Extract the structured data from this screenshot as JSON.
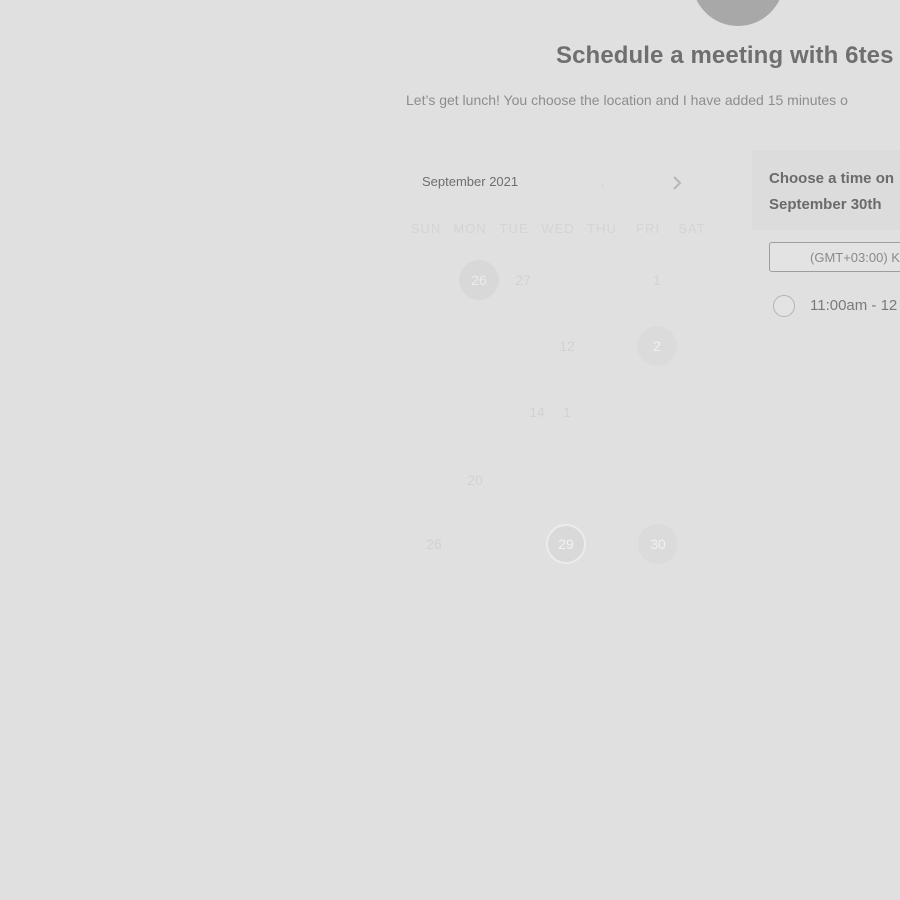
{
  "header": {
    "title": "Schedule a meeting with 6tes",
    "description": "Let’s get lunch! You choose the location and I have added 15 minutes o"
  },
  "calendar": {
    "month_label": "September 2021",
    "prev_icon": "chevron-left-icon",
    "next_icon": "chevron-right-icon",
    "weekdays": [
      "SUN",
      "MON",
      "TUE",
      "WED",
      "THU",
      "FRI",
      "SAT"
    ],
    "days": [
      {
        "label": "26",
        "state": "today"
      },
      {
        "label": "27",
        "state": "past"
      },
      {
        "label": "1",
        "state": "past"
      },
      {
        "label": "12",
        "state": "past"
      },
      {
        "label": "2",
        "state": "available"
      },
      {
        "label": "14",
        "state": "past"
      },
      {
        "label": "1",
        "state": "past"
      },
      {
        "label": "20",
        "state": "past"
      },
      {
        "label": "26",
        "state": "past"
      },
      {
        "label": "29",
        "state": "selected"
      },
      {
        "label": "30",
        "state": "available"
      }
    ]
  },
  "times": {
    "heading": "Choose a time on September 30th",
    "heading_line1": "Choose a time on",
    "heading_line2": "September 30th",
    "timezone": "(GMT+03:00) K",
    "slots": [
      {
        "label": "11:00am - 12"
      }
    ]
  }
}
